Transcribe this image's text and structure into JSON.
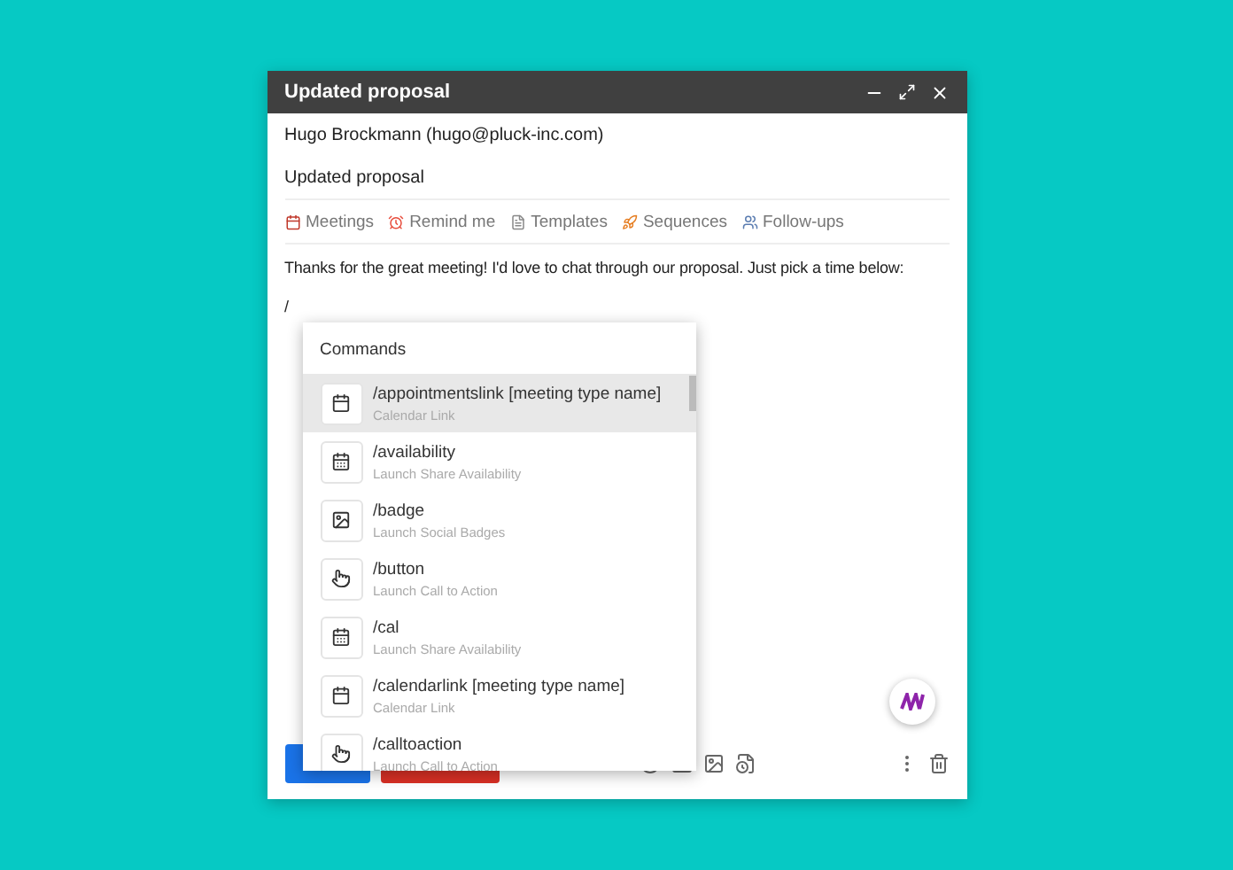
{
  "window": {
    "title": "Updated proposal"
  },
  "to": "Hugo Brockmann (hugo@pluck-inc.com)",
  "subject": "Updated proposal",
  "tools": [
    {
      "kind": "meetings",
      "label": "Meetings"
    },
    {
      "kind": "remind",
      "label": "Remind me"
    },
    {
      "kind": "templates",
      "label": "Templates"
    },
    {
      "kind": "sequences",
      "label": "Sequences"
    },
    {
      "kind": "followups",
      "label": "Follow-ups"
    }
  ],
  "body": [
    "Thanks for the great meeting! I'd love to chat through our proposal. Just pick a time below:",
    "/"
  ],
  "commands": {
    "title": "Commands",
    "items": [
      {
        "kind": "calendar",
        "command": "/appointmentslink [meeting type name]",
        "description": "Calendar Link",
        "selected": true
      },
      {
        "kind": "availability",
        "command": "/availability",
        "description": "Launch Share Availability",
        "selected": false
      },
      {
        "kind": "badge",
        "command": "/badge",
        "description": "Launch Social Badges",
        "selected": false
      },
      {
        "kind": "hand",
        "command": "/button",
        "description": "Launch Call to Action",
        "selected": false
      },
      {
        "kind": "availability",
        "command": "/cal",
        "description": "Launch Share Availability",
        "selected": false
      },
      {
        "kind": "calendar",
        "command": "/calendarlink [meeting type name]",
        "description": "Calendar Link",
        "selected": false
      },
      {
        "kind": "hand",
        "command": "/calltoaction",
        "description": "Launch Call to Action",
        "selected": false
      }
    ]
  }
}
